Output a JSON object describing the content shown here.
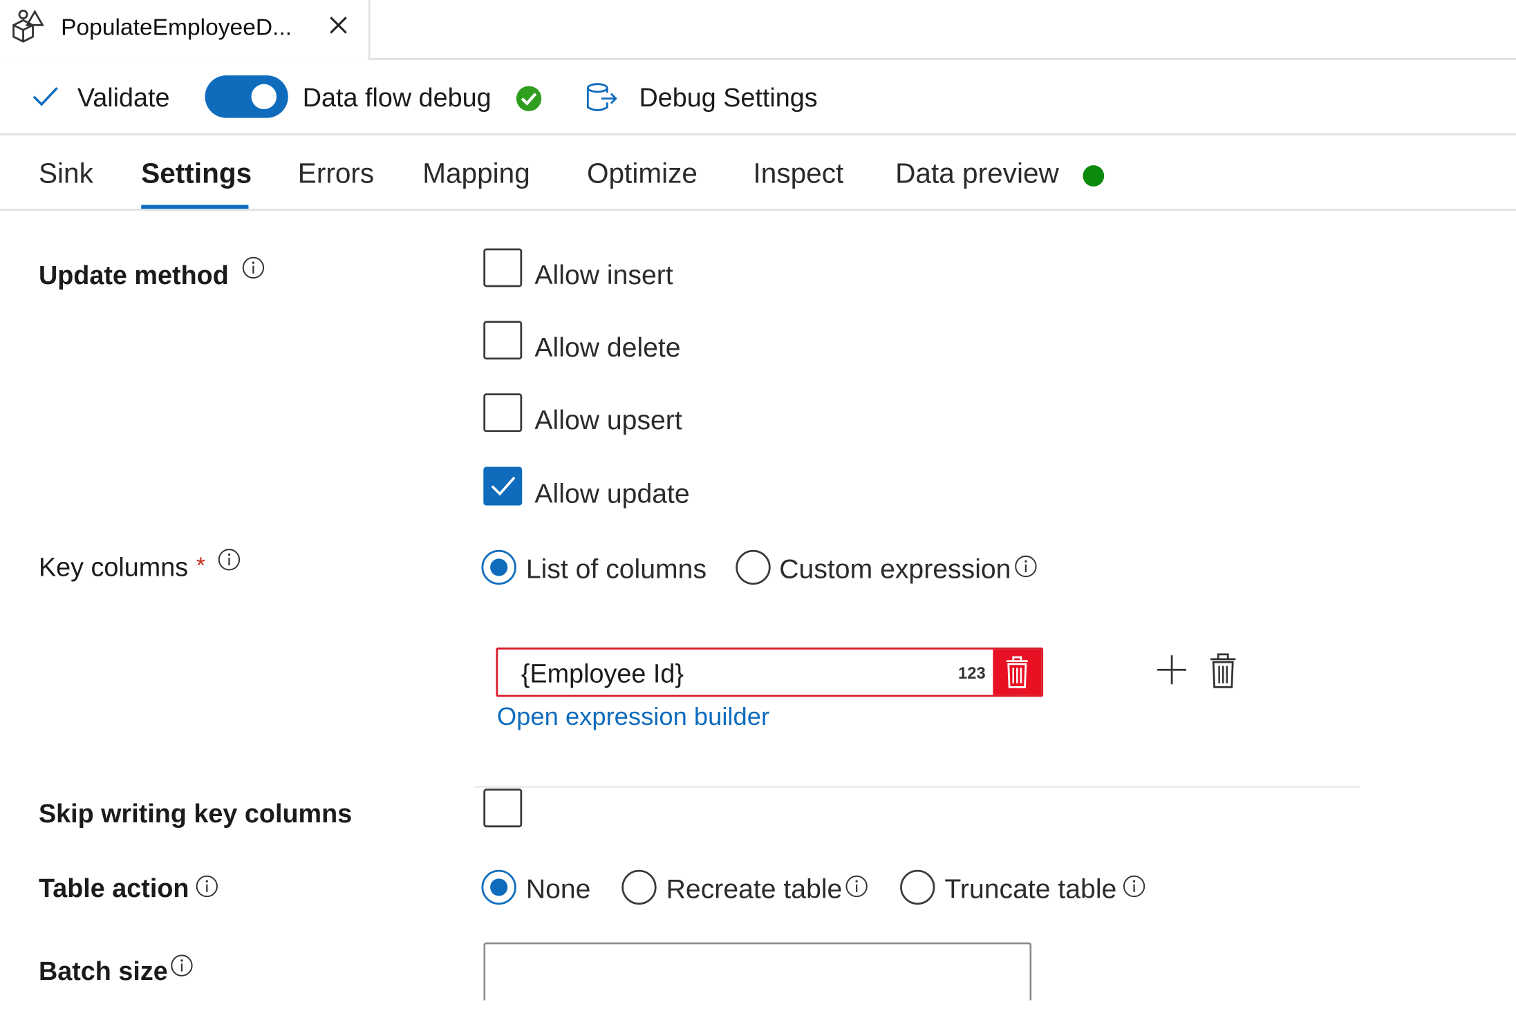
{
  "document_tab": {
    "title": "PopulateEmployeeD...",
    "icon": "data-flow-icon",
    "close_icon": "close-icon"
  },
  "toolbar": {
    "validate_label": "Validate",
    "debug_label": "Data flow debug",
    "debug_enabled": true,
    "debug_status": "success",
    "debug_settings_label": "Debug Settings"
  },
  "tabs": [
    {
      "label": "Sink"
    },
    {
      "label": "Settings",
      "active": true
    },
    {
      "label": "Errors"
    },
    {
      "label": "Mapping"
    },
    {
      "label": "Optimize"
    },
    {
      "label": "Inspect"
    },
    {
      "label": "Data preview",
      "status": "green-dot"
    }
  ],
  "form": {
    "update_method": {
      "label": "Update method",
      "options": [
        {
          "label": "Allow insert",
          "checked": false
        },
        {
          "label": "Allow delete",
          "checked": false
        },
        {
          "label": "Allow upsert",
          "checked": false
        },
        {
          "label": "Allow update",
          "checked": true
        }
      ]
    },
    "key_columns": {
      "label": "Key columns",
      "required_marker": "*",
      "options": [
        {
          "label": "List of columns",
          "selected": true
        },
        {
          "label": "Custom expression",
          "selected": false
        }
      ],
      "expression_value": "{Employee Id}",
      "type_badge": "123",
      "open_builder_link": "Open expression builder"
    },
    "skip_writing_key_columns": {
      "label": "Skip writing key columns",
      "checked": false
    },
    "table_action": {
      "label": "Table action",
      "options": [
        {
          "label": "None",
          "selected": true
        },
        {
          "label": "Recreate table",
          "selected": false
        },
        {
          "label": "Truncate table",
          "selected": false
        }
      ]
    },
    "batch_size": {
      "label": "Batch size",
      "value": ""
    }
  },
  "colors": {
    "accent": "#0f6cbd",
    "error": "#d91b2a",
    "success": "#2f9e1f",
    "preview_dot": "#0b8a0b"
  }
}
